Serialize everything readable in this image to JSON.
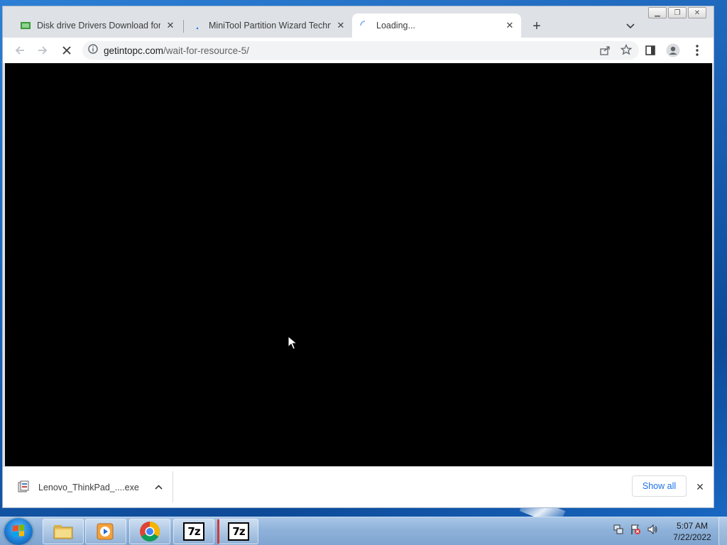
{
  "browser": {
    "tabs": [
      {
        "title": "Disk drive Drivers Download for W",
        "close": "✕"
      },
      {
        "title": "MiniTool Partition Wizard Technic",
        "close": "✕"
      },
      {
        "title": "Loading...",
        "close": "✕"
      }
    ],
    "new_tab": "+",
    "url_host": "getintopc.com",
    "url_path": "/wait-for-resource-5/"
  },
  "download_bar": {
    "filename": "Lenovo_ThinkPad_....exe",
    "show_all": "Show all",
    "close": "✕"
  },
  "taskbar": {
    "time": "5:07 AM",
    "date": "7/22/2022",
    "app_7z_1": "7z",
    "app_7z_2": "7z"
  },
  "colors": {
    "accent_blue": "#1a73e8",
    "content_bg": "#000000",
    "taskbar": "#8fb2da"
  }
}
